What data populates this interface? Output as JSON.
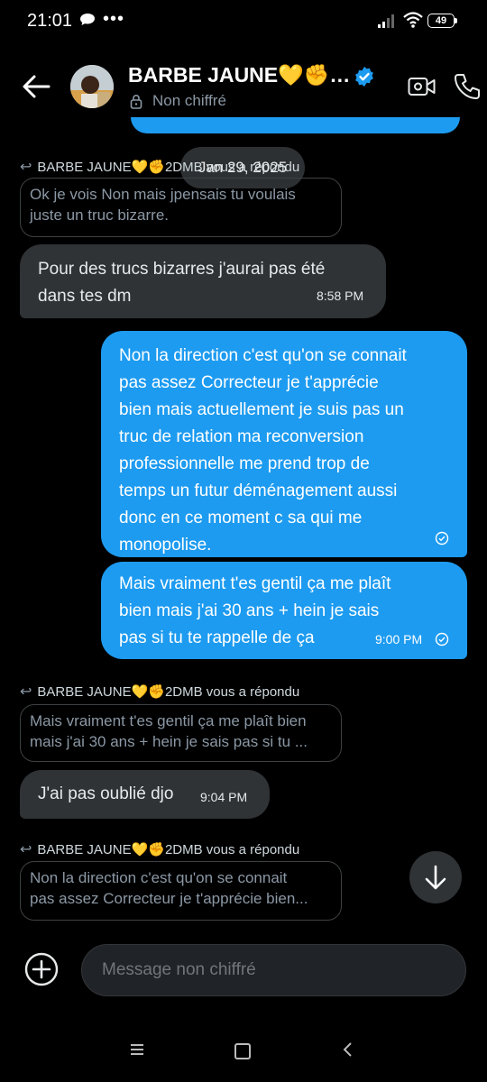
{
  "status_bar": {
    "time": "21:01",
    "more": "•••",
    "battery": "49"
  },
  "header": {
    "name": "BARBE JAUNE💛✊…",
    "subtitle": "Non chiffré"
  },
  "date_chip": "Jan 29, 2025",
  "messages": [
    {
      "reply_to": "BARBE JAUNE💛✊2DMB vous a répondu",
      "quote_lines": [
        "Ok je vois Non mais jpensais tu voulais",
        "juste un truc bizarre."
      ]
    },
    {
      "direction": "in",
      "lines": [
        "Pour des trucs bizarres j'aurai pas été",
        "dans tes dm"
      ],
      "time": "8:58 PM"
    },
    {
      "direction": "out",
      "lines": [
        "Non la direction c'est qu'on se connait",
        "pas assez Correcteur je t'apprécie",
        "bien mais actuellement je suis pas un",
        "truc de relation ma reconversion",
        "professionnelle me prend trop de",
        "temps un futur déménagement aussi",
        "donc en ce moment c sa qui me",
        "monopolise."
      ]
    },
    {
      "direction": "out",
      "lines": [
        "Mais vraiment t'es gentil ça me plaît",
        "bien mais j'ai  30 ans + hein je sais",
        "pas si tu te rappelle de ça"
      ],
      "time": "9:00 PM"
    },
    {
      "reply_to": "BARBE JAUNE💛✊2DMB vous a répondu",
      "quote_lines": [
        "Mais vraiment t'es gentil ça me plaît bien",
        "mais j'ai  30 ans + hein je sais pas si tu ..."
      ]
    },
    {
      "direction": "in",
      "text": "J'ai pas oublié djo",
      "time": "9:04 PM"
    },
    {
      "reply_to": "BARBE JAUNE💛✊2DMB vous a répondu",
      "quote_lines": [
        "Non la direction c'est qu'on se connait",
        "pas assez Correcteur je t'apprécie bien..."
      ]
    }
  ],
  "composer": {
    "placeholder": "Message non chiffré"
  },
  "colors": {
    "accent": "#1d9bf0",
    "bubble_in": "#2f3336",
    "background": "#000000"
  }
}
